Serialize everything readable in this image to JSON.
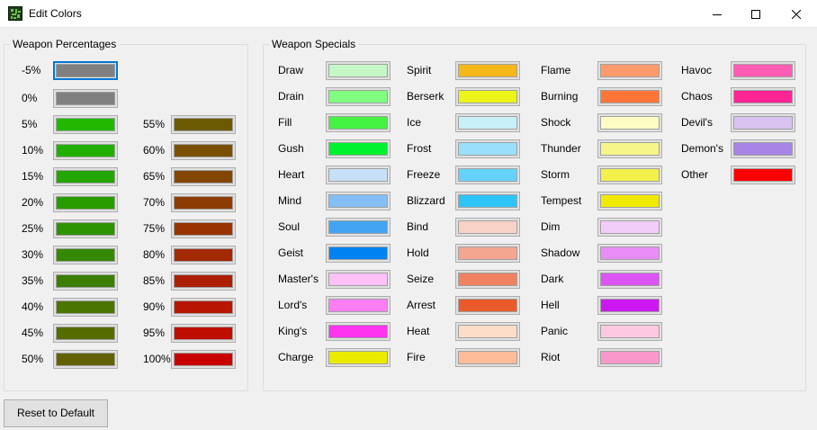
{
  "window": {
    "title": "Edit Colors",
    "app_icon": "grid-app-icon",
    "controls": [
      "minimize-icon",
      "maximize-icon",
      "close-icon"
    ]
  },
  "weapon_percentages": {
    "title": "Weapon Percentages",
    "items": [
      {
        "label": "-5%",
        "color": "#808080"
      },
      {
        "label": "0%",
        "color": "#808080"
      },
      {
        "label": "5%",
        "color": "#22b800"
      },
      {
        "label": "10%",
        "color": "#22b000"
      },
      {
        "label": "15%",
        "color": "#24a600"
      },
      {
        "label": "20%",
        "color": "#299d00"
      },
      {
        "label": "25%",
        "color": "#2e9300"
      },
      {
        "label": "30%",
        "color": "#358800"
      },
      {
        "label": "35%",
        "color": "#3c7e00"
      },
      {
        "label": "40%",
        "color": "#4a7500"
      },
      {
        "label": "45%",
        "color": "#566c00"
      },
      {
        "label": "50%",
        "color": "#626300"
      },
      {
        "label": "55%",
        "color": "#6c5a00"
      },
      {
        "label": "60%",
        "color": "#7a5000"
      },
      {
        "label": "65%",
        "color": "#834600"
      },
      {
        "label": "70%",
        "color": "#8c3c00"
      },
      {
        "label": "75%",
        "color": "#983300"
      },
      {
        "label": "80%",
        "color": "#a22900"
      },
      {
        "label": "85%",
        "color": "#ac1f00"
      },
      {
        "label": "90%",
        "color": "#b71600"
      },
      {
        "label": "95%",
        "color": "#bf0d00"
      },
      {
        "label": "100%",
        "color": "#c80000"
      }
    ]
  },
  "weapon_specials": {
    "title": "Weapon Specials",
    "columns": [
      [
        {
          "label": "Draw",
          "color": "#c6f7c6"
        },
        {
          "label": "Drain",
          "color": "#80ff80"
        },
        {
          "label": "Fill",
          "color": "#44f244"
        },
        {
          "label": "Gush",
          "color": "#00f22c"
        },
        {
          "label": "Heart",
          "color": "#c7e0f7"
        },
        {
          "label": "Mind",
          "color": "#84bef5"
        },
        {
          "label": "Soul",
          "color": "#44a4f4"
        },
        {
          "label": "Geist",
          "color": "#0082f0"
        },
        {
          "label": "Master's",
          "color": "#ffc0f8"
        },
        {
          "label": "Lord's",
          "color": "#ff7ef4"
        },
        {
          "label": "King's",
          "color": "#ff34ee"
        },
        {
          "label": "Charge",
          "color": "#ebeb00"
        }
      ],
      [
        {
          "label": "Spirit",
          "color": "#f6b718"
        },
        {
          "label": "Berserk",
          "color": "#ecf418"
        },
        {
          "label": "Ice",
          "color": "#c8f0f8"
        },
        {
          "label": "Frost",
          "color": "#98e0fc"
        },
        {
          "label": "Freeze",
          "color": "#64d2fc"
        },
        {
          "label": "Blizzard",
          "color": "#2ec4f8"
        },
        {
          "label": "Bind",
          "color": "#f8d2c6"
        },
        {
          "label": "Hold",
          "color": "#f4a690"
        },
        {
          "label": "Seize",
          "color": "#f08262"
        },
        {
          "label": "Arrest",
          "color": "#ea5a2a"
        },
        {
          "label": "Heat",
          "color": "#fddcc8"
        },
        {
          "label": "Fire",
          "color": "#ffbc98"
        }
      ],
      [
        {
          "label": "Flame",
          "color": "#ff9a6c"
        },
        {
          "label": "Burning",
          "color": "#ff7538"
        },
        {
          "label": "Shock",
          "color": "#fefbc4"
        },
        {
          "label": "Thunder",
          "color": "#f6f58a"
        },
        {
          "label": "Storm",
          "color": "#f3f04c"
        },
        {
          "label": "Tempest",
          "color": "#efea00"
        },
        {
          "label": "Dim",
          "color": "#f2ccf8"
        },
        {
          "label": "Shadow",
          "color": "#e88cf6"
        },
        {
          "label": "Dark",
          "color": "#dc54f4"
        },
        {
          "label": "Hell",
          "color": "#cc18f0"
        },
        {
          "label": "Panic",
          "color": "#fcc8e2"
        },
        {
          "label": "Riot",
          "color": "#fa98cc"
        }
      ],
      [
        {
          "label": "Havoc",
          "color": "#ff5cb4"
        },
        {
          "label": "Chaos",
          "color": "#ff2496"
        },
        {
          "label": "Devil's",
          "color": "#d8c2f0"
        },
        {
          "label": "Demon's",
          "color": "#a884e4"
        },
        {
          "label": "Other",
          "color": "#ff0000"
        }
      ]
    ]
  },
  "reset_button": {
    "label": "Reset to Default"
  }
}
